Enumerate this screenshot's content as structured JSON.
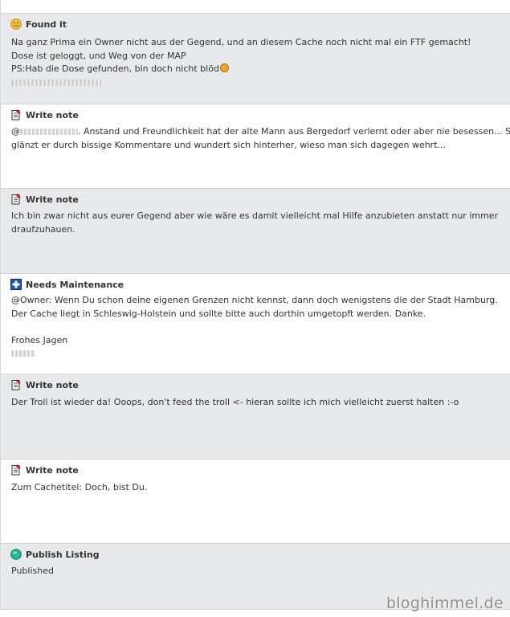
{
  "logs": [
    {
      "type": "Found it",
      "icon": "smiley-icon",
      "lines": [
        "Na ganz Prima ein Owner nicht aus der Gegend, und an diesem Cache noch nicht mal ein FTF gemacht!",
        "Dose ist geloggt, und Weg von der MAP",
        "PS:Hab die Dose gefunden, bin doch nicht blöd"
      ]
    },
    {
      "type": "Write note",
      "icon": "note-icon",
      "lines": [
        ". Anstand und Freundlichkeit hat der alte Mann aus Bergedorf verlernt oder aber nie besessen... S",
        "glänzt er durch bissige Kommentare und wundert sich hinterher, wieso man sich dagegen wehrt..."
      ]
    },
    {
      "type": "Write note",
      "icon": "note-icon",
      "lines": [
        "Ich bin zwar nicht aus eurer Gegend aber wie wäre es damit vielleicht mal Hilfe anzubieten anstatt nur immer",
        "draufzuhauen."
      ]
    },
    {
      "type": "Needs Maintenance",
      "icon": "maintenance-icon",
      "lines": [
        "@Owner: Wenn Du schon deine eigenen Grenzen nicht kennst, dann doch wenigstens die der Stadt Hamburg.",
        "Der Cache liegt in Schleswig-Holstein und sollte bitte auch dorthin umgetopft werden. Danke.",
        "Frohes Jagen"
      ]
    },
    {
      "type": "Write note",
      "icon": "note-icon",
      "lines": [
        "Der Troll ist wieder da! Ooops, don't feed the troll <- hieran sollte ich mich vielleicht zuerst halten :-o"
      ]
    },
    {
      "type": "Write note",
      "icon": "note-icon",
      "lines": [
        "Zum Cachetitel: Doch, bist Du."
      ]
    },
    {
      "type": "Publish Listing",
      "icon": "publish-icon",
      "lines": [
        "Published"
      ]
    }
  ],
  "watermark": "bloghimmel.de",
  "colors": {
    "shaded_background": "#e8e9eb",
    "plain_background": "#ffffff",
    "text": "#333333",
    "watermark": "#8f8f8f"
  }
}
